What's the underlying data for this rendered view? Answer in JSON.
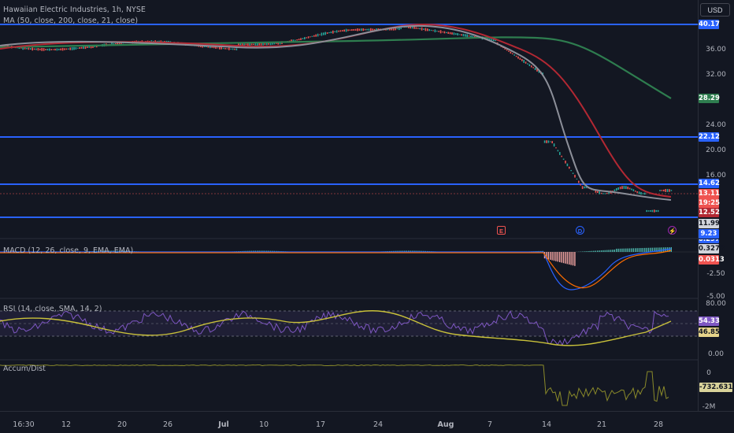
{
  "legends": {
    "symbol": "Hawaiian Electric Industries, 1h, NYSE",
    "ma": "MA (50, close, 200, close, 21, close)",
    "macd": "MACD (12, 26, close, 9, EMA, EMA)",
    "rsi": "RSI (14, close, SMA, 14, 2)",
    "accum": "Accum/Dist"
  },
  "currency": "USD",
  "price_ticks": [
    "36.00",
    "32.00",
    "24.00",
    "20.00",
    "16.00"
  ],
  "price_badges": {
    "hline_top": "40.17",
    "ma200": "28.29",
    "hline_mid": "22.12",
    "hline_low": "14.62",
    "last_price": "13.11",
    "countdown": "19:25",
    "ma50": "12.52",
    "ma21": "11.99",
    "hline_bottom": "9.23"
  },
  "macd": {
    "ticks": [
      "-2.50",
      "-5.00"
    ],
    "top_partial": "0.2971",
    "badge1": "0.3278",
    "badge2": "0.0313"
  },
  "rsi": {
    "ticks": [
      "80.00",
      "0.00"
    ],
    "badge1": "54.33",
    "badge2": "46.85"
  },
  "accum": {
    "ticks": [
      "0",
      "-2M"
    ],
    "badge": "-732.631K"
  },
  "x_labels": [
    "16:30",
    "12",
    "20",
    "26",
    "Jul",
    "10",
    "17",
    "24",
    "Aug",
    "7",
    "14",
    "21",
    "28"
  ],
  "events": [
    "E",
    "D",
    "⚡"
  ],
  "colors": {
    "background": "#131722",
    "hline": "#2962ff",
    "ma50": "#b22833",
    "ma21": "#8c8f99",
    "ma200": "#2e7d4f",
    "macd": "#2962ff",
    "signal": "#ff6d00",
    "rsi": "#7e57c2",
    "rsi_ma": "#c9c13a",
    "accum": "#8a8a2a",
    "up": "#26a69a",
    "down": "#ef5350"
  }
}
